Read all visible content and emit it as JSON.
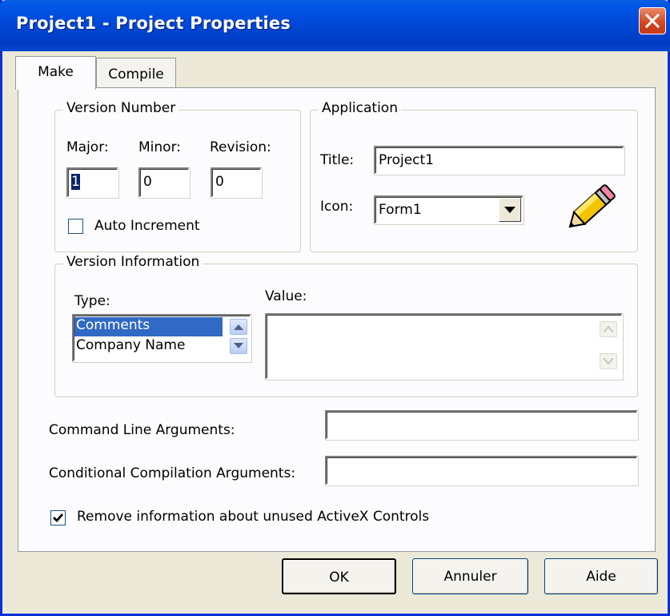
{
  "window": {
    "title": "Project1 - Project Properties"
  },
  "tabs": [
    {
      "label": "Make",
      "active": true
    },
    {
      "label": "Compile",
      "active": false
    }
  ],
  "version_number": {
    "legend": "Version Number",
    "major_label": "Major:",
    "minor_label": "Minor:",
    "revision_label": "Revision:",
    "major_value": "1",
    "minor_value": "0",
    "revision_value": "0",
    "auto_increment_label": "Auto Increment",
    "auto_increment_checked": false
  },
  "application": {
    "legend": "Application",
    "title_label": "Title:",
    "title_value": "Project1",
    "icon_label": "Icon:",
    "icon_value": "Form1",
    "icon_preview": "pencil-icon"
  },
  "version_information": {
    "legend": "Version Information",
    "type_label": "Type:",
    "value_label": "Value:",
    "types": [
      "Comments",
      "Company Name"
    ],
    "selected_type": "Comments",
    "value": ""
  },
  "command_line": {
    "label": "Command Line Arguments:",
    "value": ""
  },
  "conditional_compilation": {
    "label": "Conditional Compilation Arguments:",
    "value": ""
  },
  "remove_activex": {
    "label": "Remove information about unused ActiveX Controls",
    "checked": true
  },
  "buttons": {
    "ok": "OK",
    "cancel": "Annuler",
    "help": "Aide"
  },
  "colors": {
    "title_bar": "#0054e3",
    "dialog_bg": "#ece9d8",
    "selection": "#316ac5",
    "close_button": "#d3431e"
  }
}
